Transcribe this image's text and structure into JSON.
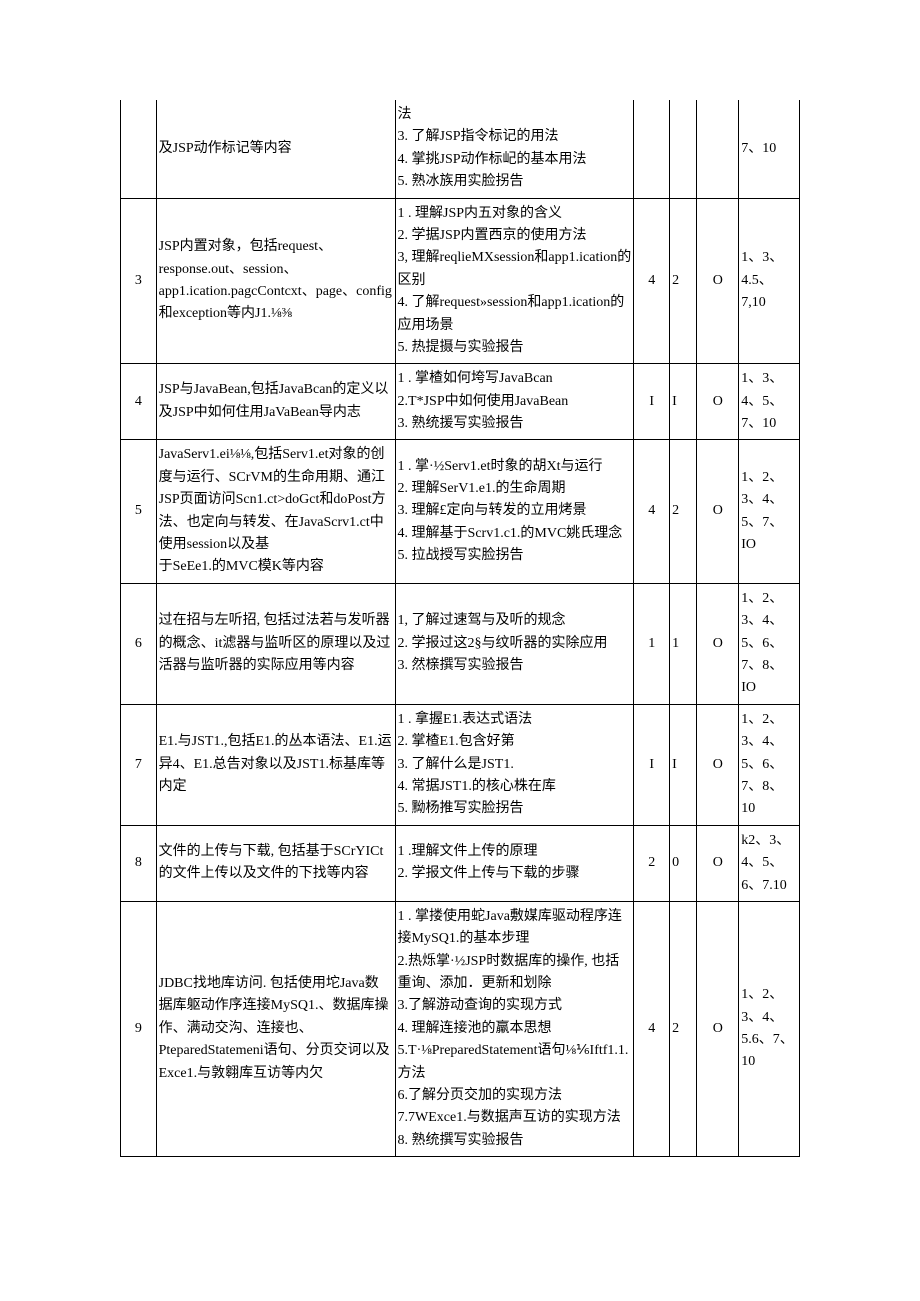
{
  "rows": [
    {
      "num": "",
      "topic": "及JSP动作标记等内容",
      "objectives": "法\n3. 了解JSP指令标记的用法\n4. 掌挑JSP动作标屺的基本用法\n5. 熟冰族用实脸拐告",
      "a": "",
      "b": "",
      "c": "",
      "ref": "7、10",
      "partial": true
    },
    {
      "num": "3",
      "topic": "JSP内置对象，包括request、response.out、session、app1.ication.pagcContcxt、page、config和exception等内J1.⅛⅜",
      "objectives": "1            . 理解JSP内五对象的含义\n2. 学据JSP内置西京的使用方法\n3, 理解reqlieMXsession和app1.ication的区别\n4. 了解request»session和app1.ication的应用场景\n5. 热提摄与实验报告",
      "a": "4",
      "b": "2",
      "c": "O",
      "ref": "1、3、4.5、7,10"
    },
    {
      "num": "4",
      "topic": "JSP与JavaBean,包括JavaBcan的定义以及JSP中如何住用JaVaBean导内志",
      "objectives": "1            . 掌楂如何垮写JavaBcan\n2.T*JSP中如何使用JavaBean\n3. 熟统援写实验报告",
      "a": "I",
      "b": "I",
      "c": "O",
      "ref": "1、3、4、5、7、10"
    },
    {
      "num": "5",
      "topic": "JavaServ1.ei⅛⅛,包括Serv1.et对象的创度与运行、SCrVM的生命用期、通江JSP页面访问Scn1.ct>doGct和doPost方法、也定向与转发、在JavaScrv1.ct中使用session以及基\n于SeEe1.的MVC模K等内容",
      "objectives": "1            . 掌·½Serv1.et时象的胡Xt与运行\n2. 理解SerV1.e1.的生命周期\n3. 理解£定向与转发的立用烤景\n4. 理解基于Scrv1.c1.的MVC姚氏理念\n5. 拉战授写实脸拐告",
      "a": "4",
      "b": "2",
      "c": "O",
      "ref": "1、2、3、4、5、7、IO"
    },
    {
      "num": "6",
      "topic": "过在招与左听招, 包括过法若与发听器的概念、it滤器与监听区的原理以及过活器与监听器的实际应用等内容",
      "objectives": "1, 了解过速驾与及听的规念\n2. 学报过这2§与纹听器的实除应用\n3. 然榇撰写实验报告",
      "a": "1",
      "b": "1",
      "c": "O",
      "ref": "1、2、3、4、5、6、7、8、IO"
    },
    {
      "num": "7",
      "topic": "E1.与JST1.,包括E1.的丛本语法、E1.运异4、E1.总告对象以及JST1.标基库等内定",
      "objectives": "1            . 拿握E1.表达式语法\n2. 掌楂E1.包含好第\n3. 了解什么是JST1.\n4. 常据JST1.的核心株在库\n5. 黝杨推写实脸拐告",
      "a": "I",
      "b": "I",
      "c": "O",
      "ref": "1、2、3、4、5、6、7、8、10"
    },
    {
      "num": "8",
      "topic": "文件的上传与下载, 包括基于SCrYICt的文件上传以及文件的下找等内容",
      "objectives": "1            .理解文件上传的原理\n2. 学报文件上传与下载的步骤",
      "a": "2",
      "b": "0",
      "c": "O",
      "ref": "k2、3、4、5、6、7.10"
    },
    {
      "num": "9",
      "topic": "JDBC找地库访问. 包括使用坨Java数据库躯动作序连接MySQ1.、数据库操作、满动交沟、连接也、PteparedStatemeni语句、分页交诃以及Exce1.与敦翱库互访等内欠",
      "objectives": "1            . 掌搂使用蛇Java敷媒库驱动程序连接MySQ1.的基本步理\n2.热烁掌·½JSP时数据库的操作, 也括重询、添加．更新和划除\n3.了解游动查询的实现方式\n4. 理解连接池的羸本思想\n5.T·⅛PreparedStatement语句⅛⅙Iftf1.1.方法\n6.了解分页交加的实现方法\n7.7WExce1.与数据声互访的实现方法\n8. 熟统撰写实验报告",
      "a": "4",
      "b": "2",
      "c": "O",
      "ref": "1、2、3、4、5.6、7、10"
    }
  ]
}
